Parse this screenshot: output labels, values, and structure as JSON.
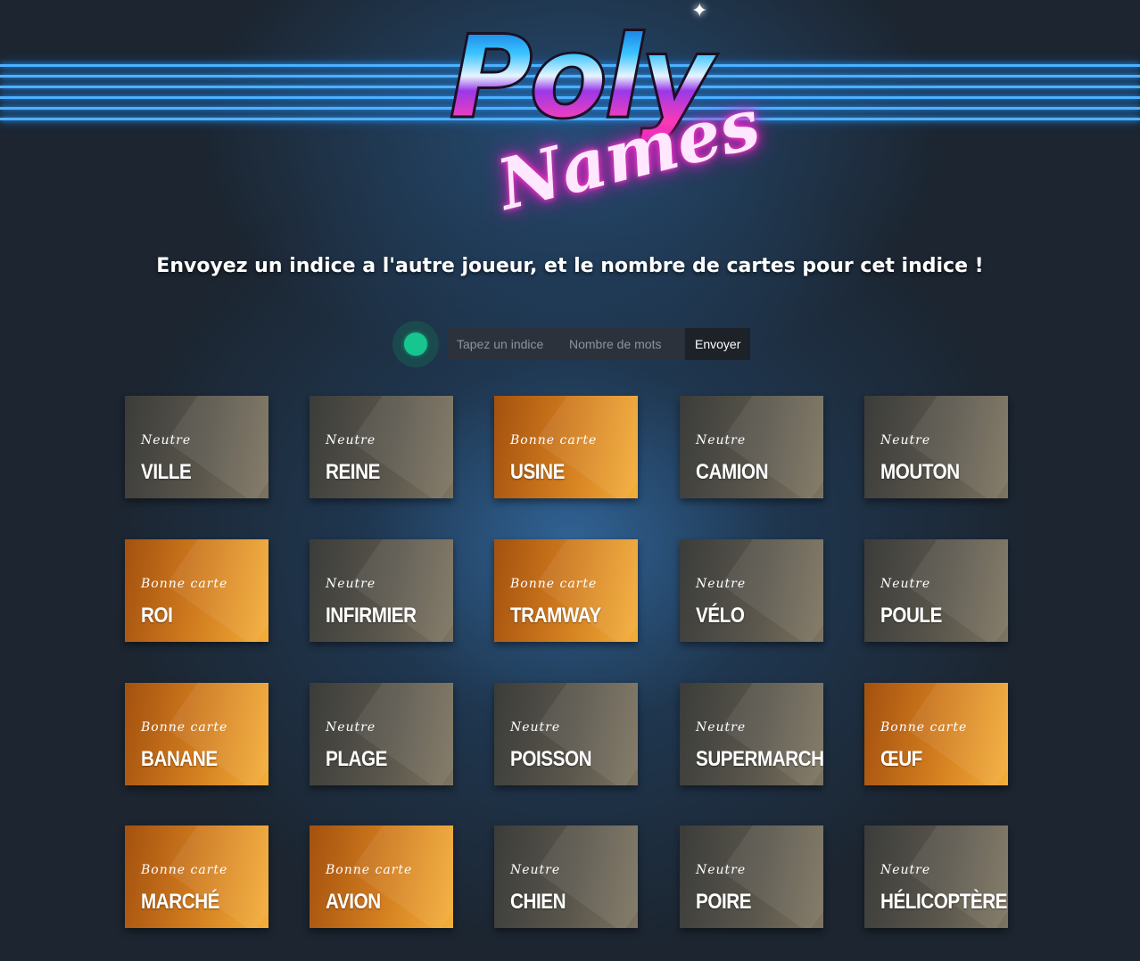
{
  "logo": {
    "line1": "Poly",
    "line2": "Names"
  },
  "instruction": "Envoyez un indice a l'autre joueur, et le nombre de cartes pour cet indice !",
  "form": {
    "clue_placeholder": "Tapez un indice",
    "count_placeholder": "Nombre de mots",
    "send_label": "Envoyer",
    "status_color": "#17c68e"
  },
  "colors": {
    "neutre": "#5a564c",
    "bonne_carte": "#d07b1e",
    "neon": "#4fb3ff"
  },
  "cards": [
    {
      "type": "Neutre",
      "word": "VILLE",
      "kind": "neutre"
    },
    {
      "type": "Neutre",
      "word": "REINE",
      "kind": "neutre"
    },
    {
      "type": "Bonne carte",
      "word": "USINE",
      "kind": "good"
    },
    {
      "type": "Neutre",
      "word": "CAMION",
      "kind": "neutre"
    },
    {
      "type": "Neutre",
      "word": "MOUTON",
      "kind": "neutre"
    },
    {
      "type": "Bonne carte",
      "word": "ROI",
      "kind": "good"
    },
    {
      "type": "Neutre",
      "word": "INFIRMIER",
      "kind": "neutre"
    },
    {
      "type": "Bonne carte",
      "word": "TRAMWAY",
      "kind": "good"
    },
    {
      "type": "Neutre",
      "word": "VÉLO",
      "kind": "neutre"
    },
    {
      "type": "Neutre",
      "word": "POULE",
      "kind": "neutre"
    },
    {
      "type": "Bonne carte",
      "word": "BANANE",
      "kind": "good"
    },
    {
      "type": "Neutre",
      "word": "PLAGE",
      "kind": "neutre"
    },
    {
      "type": "Neutre",
      "word": "POISSON",
      "kind": "neutre"
    },
    {
      "type": "Neutre",
      "word": "SUPERMARCHÉ",
      "kind": "neutre"
    },
    {
      "type": "Bonne carte",
      "word": "ŒUF",
      "kind": "good"
    },
    {
      "type": "Bonne carte",
      "word": "MARCHÉ",
      "kind": "good"
    },
    {
      "type": "Bonne carte",
      "word": "AVION",
      "kind": "good"
    },
    {
      "type": "Neutre",
      "word": "CHIEN",
      "kind": "neutre"
    },
    {
      "type": "Neutre",
      "word": "POIRE",
      "kind": "neutre"
    },
    {
      "type": "Neutre",
      "word": "HÉLICOPTÈRE",
      "kind": "neutre"
    }
  ]
}
